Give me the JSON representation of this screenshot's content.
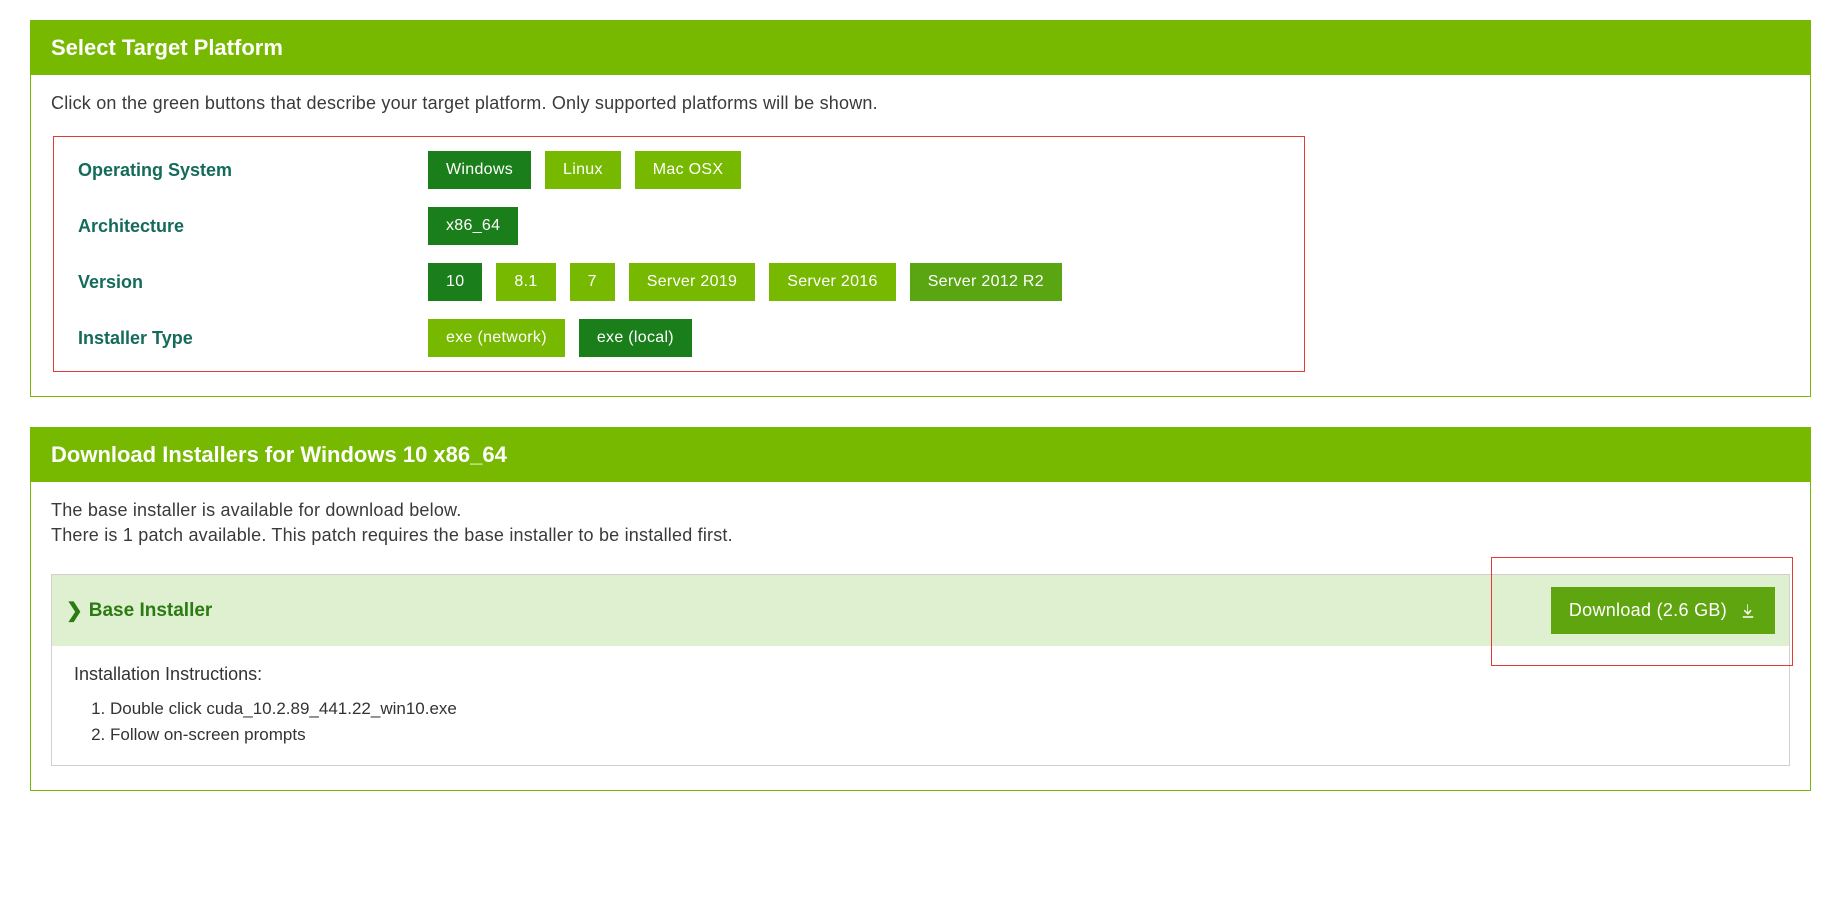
{
  "platform_panel": {
    "title": "Select Target Platform",
    "intro": "Click on the green buttons that describe your target platform. Only supported platforms will be shown.",
    "rows": [
      {
        "label": "Operating System",
        "options": [
          {
            "label": "Windows",
            "selected": true
          },
          {
            "label": "Linux",
            "selected": false
          },
          {
            "label": "Mac OSX",
            "selected": false
          }
        ]
      },
      {
        "label": "Architecture",
        "options": [
          {
            "label": "x86_64",
            "selected": true
          }
        ]
      },
      {
        "label": "Version",
        "options": [
          {
            "label": "10",
            "selected": true
          },
          {
            "label": "8.1",
            "selected": false
          },
          {
            "label": "7",
            "selected": false
          },
          {
            "label": "Server 2019",
            "selected": false
          },
          {
            "label": "Server 2016",
            "selected": false
          },
          {
            "label": "Server 2012 R2",
            "selected": false,
            "variant": "mid"
          }
        ]
      },
      {
        "label": "Installer Type",
        "options": [
          {
            "label": "exe (network)",
            "selected": false
          },
          {
            "label": "exe (local)",
            "selected": true
          }
        ]
      }
    ]
  },
  "install_panel": {
    "title": "Download Installers for Windows 10 x86_64",
    "intro_lines": [
      "The base installer is available for download below.",
      "There is 1 patch available. This patch requires the base installer to be installed first."
    ],
    "section_title": "Base Installer",
    "download_label": "Download (2.6 GB)",
    "instructions_title": "Installation Instructions:",
    "instructions": [
      "Double click cuda_10.2.89_441.22_win10.exe",
      "Follow on-screen prompts"
    ]
  }
}
